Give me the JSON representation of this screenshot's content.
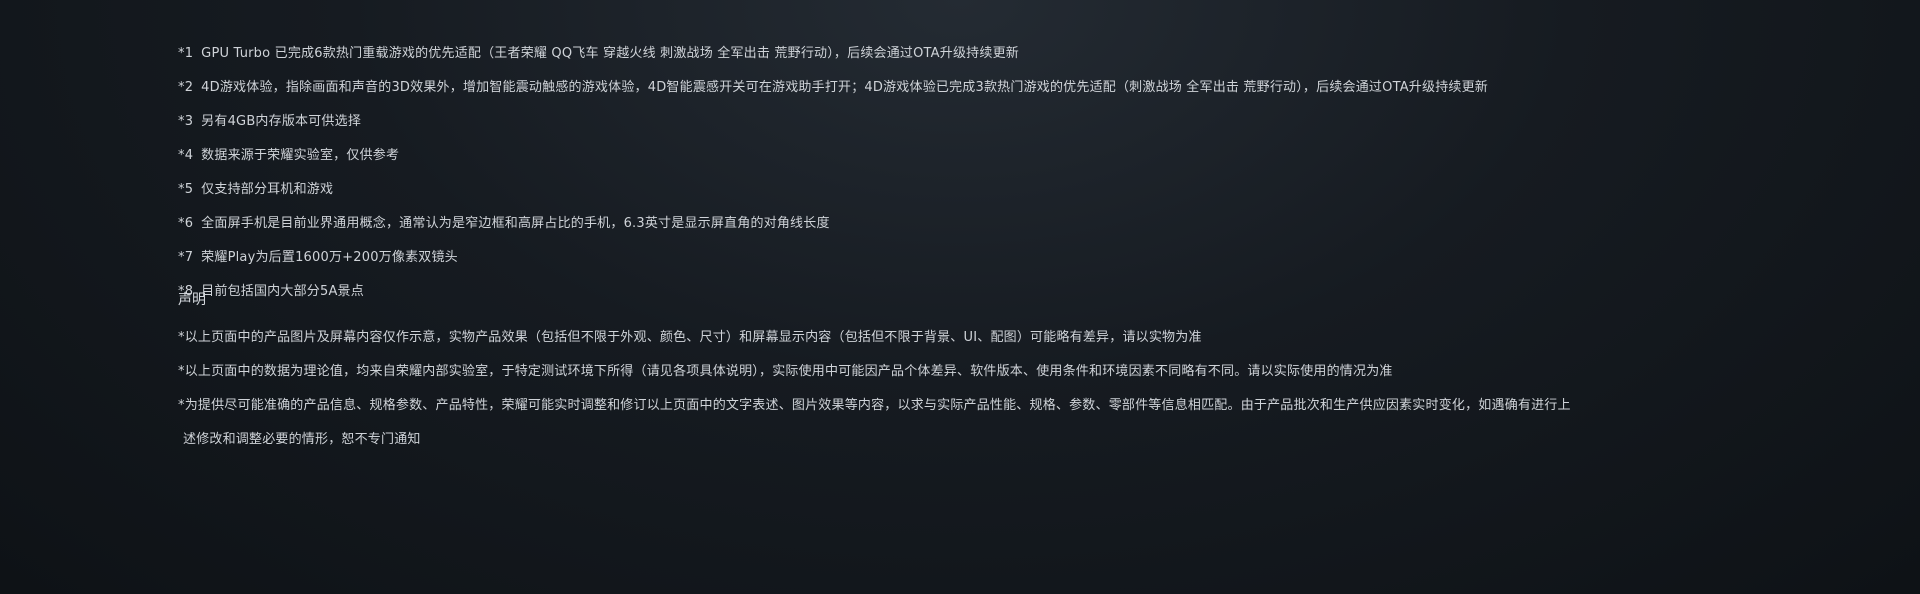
{
  "footnotes": [
    {
      "marker": "*1",
      "text": "GPU Turbo 已完成6款热门重载游戏的优先适配（王者荣耀 QQ飞车 穿越火线 刺激战场 全军出击 荒野行动），后续会通过OTA升级持续更新"
    },
    {
      "marker": "*2",
      "text": "4D游戏体验，指除画面和声音的3D效果外，增加智能震动触感的游戏体验，4D智能震感开关可在游戏助手打开；4D游戏体验已完成3款热门游戏的优先适配（刺激战场 全军出击 荒野行动），后续会通过OTA升级持续更新"
    },
    {
      "marker": "*3",
      "text": "另有4GB内存版本可供选择"
    },
    {
      "marker": "*4",
      "text": "数据来源于荣耀实验室，仅供参考"
    },
    {
      "marker": "*5",
      "text": "仅支持部分耳机和游戏"
    },
    {
      "marker": "*6",
      "text": "全面屏手机是目前业界通用概念，通常认为是窄边框和高屏占比的手机，6.3英寸是显示屏直角的对角线长度"
    },
    {
      "marker": "*7",
      "text": "荣耀Play为后置1600万+200万像素双镜头"
    },
    {
      "marker": "*8",
      "text": "目前包括国内大部分5A景点"
    }
  ],
  "declaration": {
    "title": "声明",
    "lines": [
      "*以上页面中的产品图片及屏幕内容仅作示意，实物产品效果（包括但不限于外观、颜色、尺寸）和屏幕显示内容（包括但不限于背景、UI、配图）可能略有差异，请以实物为准",
      "*以上页面中的数据为理论值，均来自荣耀内部实验室，于特定测试环境下所得（请见各项具体说明），实际使用中可能因产品个体差异、软件版本、使用条件和环境因素不同略有不同。请以实际使用的情况为准",
      "*为提供尽可能准确的产品信息、规格参数、产品特性，荣耀可能实时调整和修订以上页面中的文字表述、图片效果等内容，以求与实际产品性能、规格、参数、零部件等信息相匹配。由于产品批次和生产供应因素实时变化，如遇确有进行上",
      "述修改和调整必要的情形，恕不专门通知"
    ]
  }
}
